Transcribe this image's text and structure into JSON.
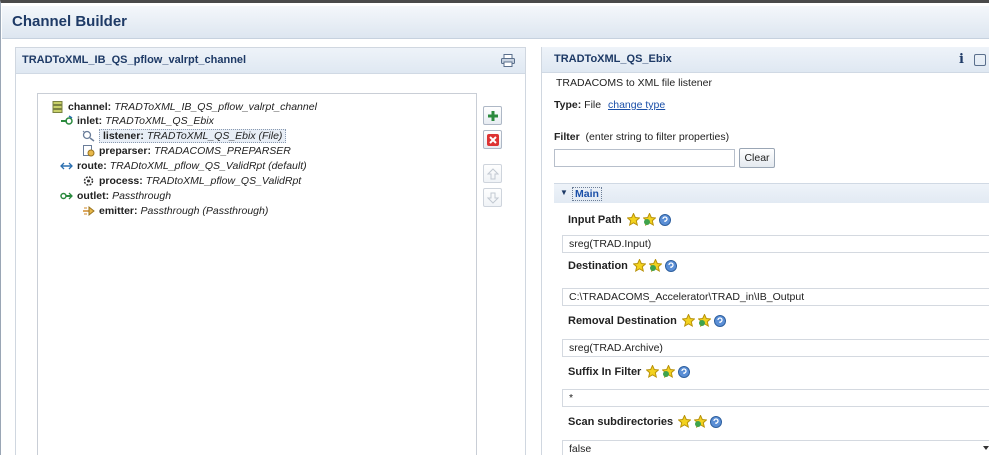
{
  "app": {
    "title": "Channel Builder"
  },
  "left_panel": {
    "title": "TRADToXML_IB_QS_pflow_valrpt_channel",
    "tree": [
      {
        "label": "channel:",
        "value": "TRADToXML_IB_QS_pflow_valrpt_channel",
        "icon": "channel-icon"
      },
      {
        "label": "inlet:",
        "value": "TRADToXML_QS_Ebix",
        "icon": "inlet-icon"
      },
      {
        "label": "listener:",
        "value": "TRADToXML_QS_Ebix (File)",
        "icon": "listener-icon",
        "selected": true
      },
      {
        "label": "preparser:",
        "value": "TRADACOMS_PREPARSER",
        "icon": "preparser-icon"
      },
      {
        "label": "route:",
        "value": "TRADtoXML_pflow_QS_ValidRpt (default)",
        "icon": "route-icon"
      },
      {
        "label": "process:",
        "value": "TRADtoXML_pflow_QS_ValidRpt",
        "icon": "process-icon"
      },
      {
        "label": "outlet:",
        "value": "Passthrough",
        "icon": "outlet-icon"
      },
      {
        "label": "emitter:",
        "value": "Passthrough (Passthrough)",
        "icon": "emitter-icon"
      }
    ]
  },
  "right_panel": {
    "title": "TRADToXML_QS_Ebix",
    "info": "i",
    "description": "TRADACOMS to XML file listener",
    "type_label": "Type:",
    "type_value": "File",
    "change_type": "change type",
    "filter_label": "Filter",
    "filter_hint": "(enter string to filter properties)",
    "filter_value": "",
    "clear_label": "Clear",
    "section_title": "Main",
    "properties": [
      {
        "label": "Input Path",
        "value": "sreg(TRAD.Input)"
      },
      {
        "label": "Destination",
        "value": "C:\\TRADACOMS_Accelerator\\TRAD_in\\IB_Output"
      },
      {
        "label": "Removal Destination",
        "value": "sreg(TRAD.Archive)"
      },
      {
        "label": "Suffix In Filter",
        "value": "*"
      },
      {
        "label": "Scan subdirectories",
        "value": "false"
      }
    ]
  }
}
